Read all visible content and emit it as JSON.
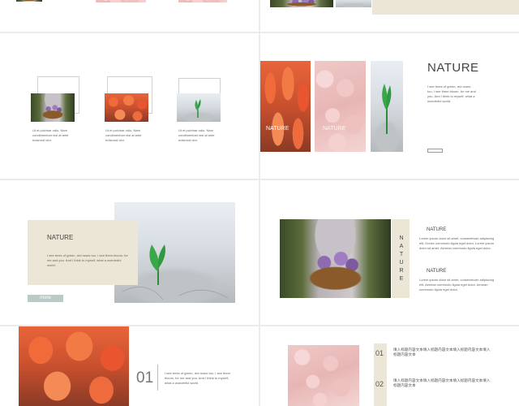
{
  "colors": {
    "beige": "#ece6d6",
    "accent_button": "#b9cbc9",
    "text": "#555555"
  },
  "slide_a": {
    "captions": [
      "Ut et pulvinar odio. Nam condimentum nisl at ante euismod olor.",
      "Ut et pulvinar odio. Nam condimentum nisl at ante euismod olor.",
      "Ut et pulvinar odio. Nam condimentum nisl at ante euismod olor."
    ]
  },
  "slide_b": {
    "title": "NATURE",
    "photo_label_1": "NATURE",
    "photo_label_2": "NATURE",
    "body": "I see trees of green, red roses too, I see them bloom, for me and you. And I think to myself, what a wonderful world."
  },
  "slide_c": {
    "title": "NATURE",
    "body": "I see trees of green, red roses too, I see them bloom, for me and you. And I think to myself, what a wonderful world.",
    "button": "more"
  },
  "slide_d": {
    "vertical_letters": [
      "N",
      "A",
      "T",
      "U",
      "R",
      "E"
    ],
    "sections": [
      {
        "title": "NATURE",
        "body": "Lorem ipsum dolor sit amet, consectetuer adipiscing elit. Donec commodo ligula eget dolor. Lorem ipsum dolor sit amet. Aenean commodo ligula eget dolor."
      },
      {
        "title": "NATURE",
        "body": "Lorem ipsum dolor sit amet, consectetuer adipiscing elit. Aenean commodo ligula eget dolor. Aenean commodo ligula eget dolor."
      }
    ]
  },
  "slide_e": {
    "number": "01",
    "body": "I see trees of green, red roses too, I see them bloom, for me and you. And I think to myself, what a wonderful world."
  },
  "slide_f": {
    "items": [
      {
        "number": "01",
        "text": "填入标题内容文本填入标题内容文本填入标题内容文本填入标题内容文本"
      },
      {
        "number": "02",
        "text": "填入标题内容文本填入标题内容文本填入标题内容文本填入标题内容文本"
      }
    ]
  }
}
